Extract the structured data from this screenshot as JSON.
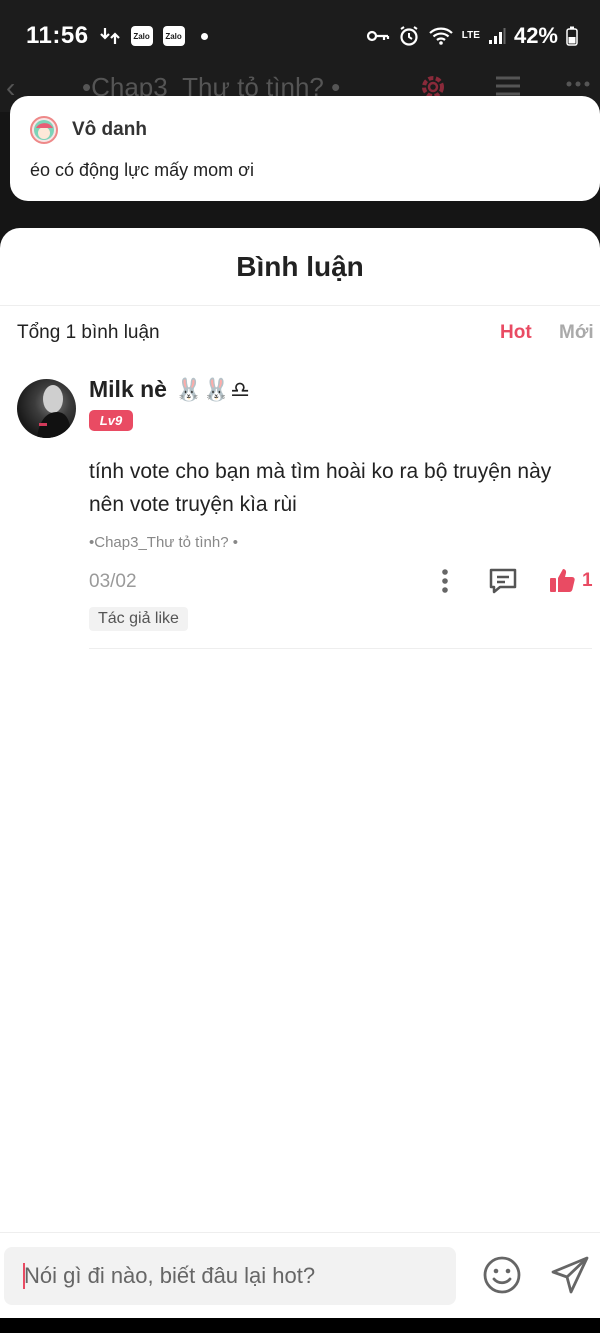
{
  "status_bar": {
    "time": "11:56",
    "zalo_1": "Zalo",
    "zalo_2": "Zalo",
    "battery": "42%",
    "network": "LTE"
  },
  "reader_bar": {
    "title": "•Chap3_Thư tỏ tình? •"
  },
  "notification": {
    "name": "Vô danh",
    "message": "éo có động lực mấy mom ơi"
  },
  "comments_sheet": {
    "title": "Bình luận",
    "count_text": "Tổng 1 bình luận",
    "sort_hot": "Hot",
    "sort_new": "Mới",
    "comments": [
      {
        "user": "Milk nè",
        "user_emoji": "🐰🐰♎",
        "level": "Lv9",
        "text": "tính vote cho bạn mà tìm hoài ko ra bộ truyện này nên vote truyện kìa rùi",
        "chapter": "•Chap3_Thư tỏ tình? •",
        "date": "03/02",
        "likes": "1",
        "author_like": "Tác giả like"
      }
    ]
  },
  "input": {
    "placeholder": "Nói gì đi nào, biết đâu lại hot?"
  },
  "colors": {
    "accent": "#e94b63",
    "background_dark": "#1c1c1c"
  },
  "icons": [
    "back-icon",
    "gear-icon",
    "list-icon",
    "more-icon",
    "more-vertical-icon",
    "reply-icon",
    "thumbs-up-icon",
    "emoji-icon",
    "send-icon",
    "key-icon",
    "alarm-icon",
    "wifi-icon",
    "signal-icon",
    "battery-icon"
  ]
}
